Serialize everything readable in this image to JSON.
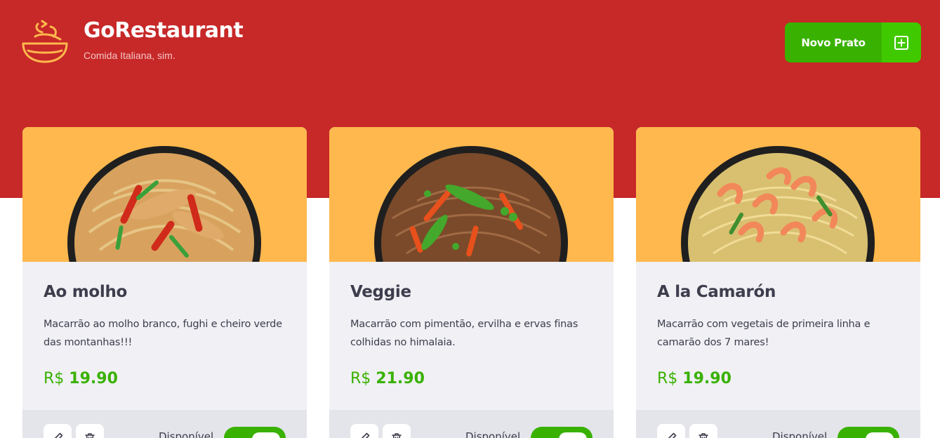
{
  "header": {
    "title": "GoRestaurant",
    "subtitle": "Comida Italiana, sim.",
    "new_button_label": "Novo Prato",
    "logo_icon": "bowl-icon",
    "add_icon": "plus-square-icon"
  },
  "colors": {
    "brand_red": "#c72828",
    "accent_green": "#39b100",
    "image_bg": "#ffb84d",
    "card_bg": "#f0f0f5"
  },
  "dishes": [
    {
      "name": "Ao molho",
      "description": "Macarrão ao molho branco, fughi e cheiro verde das montanhas!!!",
      "currency": "R$",
      "price": "19.90",
      "available_label": "Disponível",
      "available": true
    },
    {
      "name": "Veggie",
      "description": "Macarrão com pimentão, ervilha e ervas finas colhidas no himalaia.",
      "currency": "R$",
      "price": "21.90",
      "available_label": "Disponível",
      "available": true
    },
    {
      "name": "A la Camarón",
      "description": "Macarrão com vegetais de primeira linha e camarão dos 7 mares!",
      "currency": "R$",
      "price": "19.90",
      "available_label": "Disponível",
      "available": true
    }
  ]
}
